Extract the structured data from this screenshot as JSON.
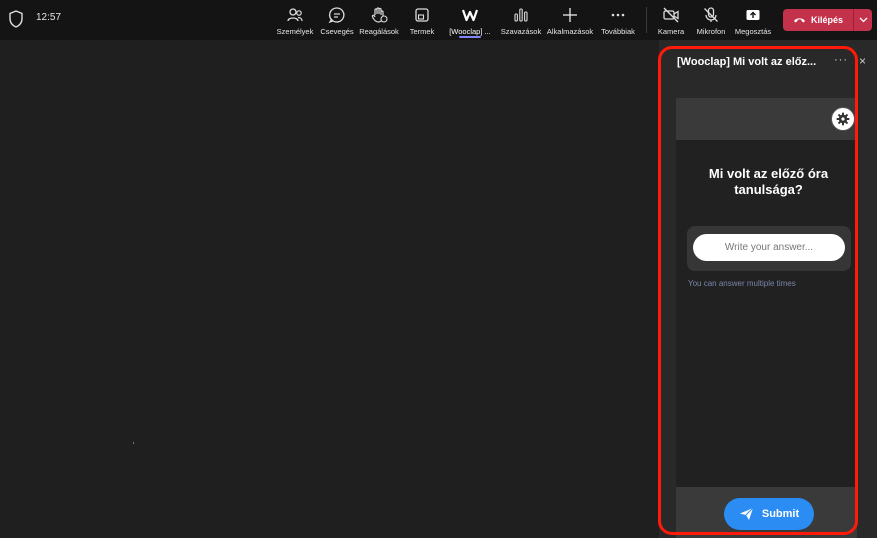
{
  "header": {
    "time": "12:57",
    "tools": [
      {
        "label": "Személyek",
        "icon": "people-icon"
      },
      {
        "label": "Csevegés",
        "icon": "chat-icon"
      },
      {
        "label": "Reagálások",
        "icon": "raise-hand-icon"
      },
      {
        "label": "Termek",
        "icon": "rooms-icon"
      },
      {
        "label": "[Wooclap] ...",
        "icon": "wooclap-icon"
      },
      {
        "label": "Szavazások",
        "icon": "polls-icon"
      },
      {
        "label": "Alkalmazások",
        "icon": "add-icon"
      },
      {
        "label": "Továbbiak",
        "icon": "more-icon"
      },
      {
        "label": "Kamera",
        "icon": "camera-off-icon"
      },
      {
        "label": "Mikrofon",
        "icon": "mic-off-icon"
      },
      {
        "label": "Megosztás",
        "icon": "share-icon"
      }
    ],
    "leave_label": "Kilépés"
  },
  "panel": {
    "title": "[Wooclap] Mi volt az előz...",
    "more": "···",
    "close": "×"
  },
  "wooclap": {
    "question": "Mi volt az előző óra tanulsága?",
    "answer_placeholder": "Write your answer...",
    "hint": "You can answer multiple times",
    "submit_label": "Submit"
  },
  "colors": {
    "leave": "#c4314b",
    "submit": "#2b8cf3",
    "highlight": "#ff1a0a",
    "active_tab": "#7f85f5"
  }
}
